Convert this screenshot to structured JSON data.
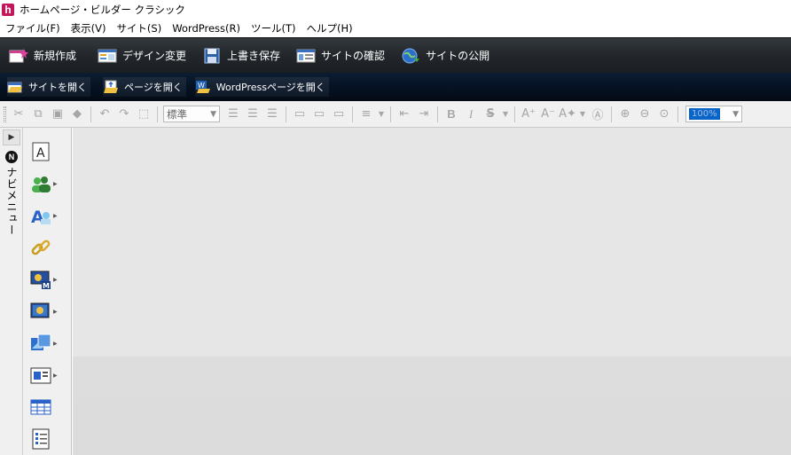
{
  "window": {
    "title": "ホームページ・ビルダー クラシック",
    "logo_letter": "h"
  },
  "menu": [
    "ファイル(F)",
    "表示(V)",
    "サイト(S)",
    "WordPress(R)",
    "ツール(T)",
    "ヘルプ(H)"
  ],
  "toolbar_main": {
    "new": "新規作成",
    "design": "デザイン変更",
    "save": "上書き保存",
    "check": "サイトの確認",
    "publish": "サイトの公開"
  },
  "toolbar_open": {
    "open_site": "サイトを開く",
    "open_page": "ページを開く",
    "open_wp": "WordPressページを開く"
  },
  "format": {
    "style_value": "標準",
    "zoom_value": "100%"
  },
  "navmenu": {
    "badge": "N",
    "label": "ナビメニュー"
  },
  "colors": {
    "toolbar_dark": "#24282d",
    "toolbar_navy": "#071426",
    "canvas": "#e6e6e6",
    "logo": "#c2185b"
  }
}
